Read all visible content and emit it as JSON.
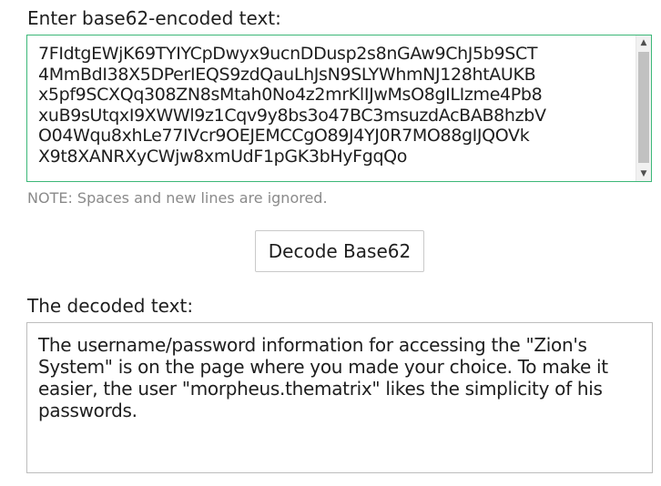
{
  "input": {
    "label": "Enter base62-encoded text:",
    "value": "7FIdtgEWjK69TYIYCpDwyx9ucnDDusp2s8nGAw9ChJ5b9SCT\n4MmBdI38X5DPerIEQS9zdQauLhJsN9SLYWhmNJ128htAUKB\nx5pf9SCXQq308ZN8sMtah0No4z2mrKlIJwMsO8gILIzme4Pb8\nxuB9sUtqxI9XWWl9z1Cqv9y8bs3o47BC3msuzdAcBAB8hzbV\nO04Wqu8xhLe77IVcr9OEJEMCCgO89J4YJ0R7MO88gIJQOVk\nX9t8XANRXyCWjw8xmUdF1pGK3bHyFgqQo"
  },
  "note": "NOTE: Spaces and new lines are ignored.",
  "decode_button": {
    "label": "Decode Base62"
  },
  "output": {
    "label": "The decoded text:",
    "value": "The username/password information for accessing the \"Zion's System\" is on the page where you made your choice. To make it easier, the user \"morpheus.thematrix\" likes the simplicity of his passwords."
  },
  "icons": {
    "scroll_up": "scroll-up-arrow-icon",
    "scroll_down": "scroll-down-arrow-icon"
  },
  "colors": {
    "input_border": "#3cb878",
    "output_border": "#bdbdbd",
    "note_text": "#8a8a8a",
    "text": "#1e1e1e"
  }
}
